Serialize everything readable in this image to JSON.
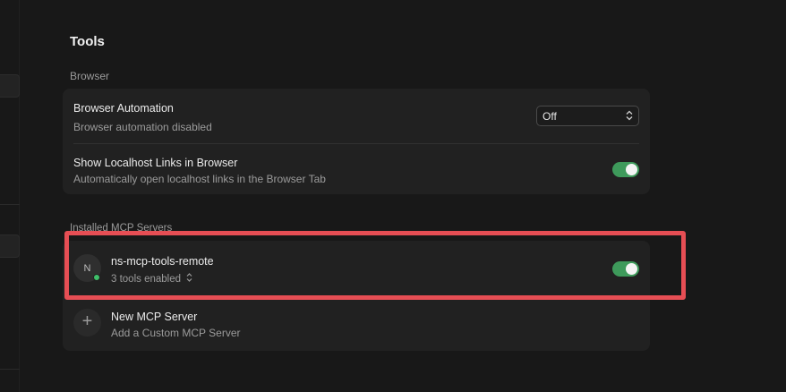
{
  "page": {
    "title": "Tools"
  },
  "browser_section": {
    "label": "Browser",
    "automation": {
      "title": "Browser Automation",
      "subtitle": "Browser automation disabled",
      "select_value": "Off"
    },
    "localhost": {
      "title": "Show Localhost Links in Browser",
      "subtitle": "Automatically open localhost links in the Browser Tab",
      "enabled": true
    }
  },
  "mcp_section": {
    "label": "Installed MCP Servers",
    "servers": [
      {
        "avatar_letter": "N",
        "name": "ns-mcp-tools-remote",
        "tools_text": "3 tools enabled",
        "enabled": true,
        "status": "connected"
      }
    ],
    "add": {
      "title": "New MCP Server",
      "subtitle": "Add a Custom MCP Server"
    }
  },
  "colors": {
    "accent_toggle": "#3e9a5b",
    "highlight": "#e64e54",
    "status_online": "#3fbf6a"
  }
}
